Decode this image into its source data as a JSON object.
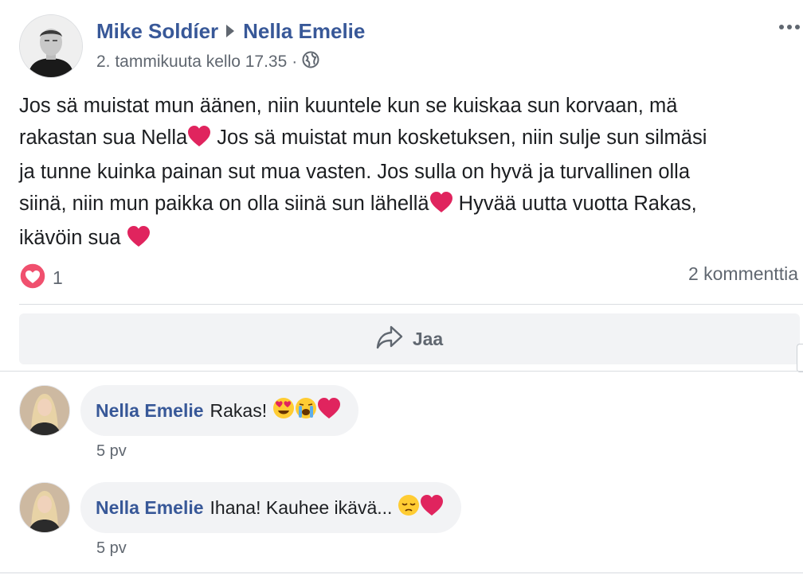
{
  "post": {
    "author": "Mike Soldíer",
    "recipient": "Nella Emelie",
    "timestamp": "2. tammikuuta kello 17.35",
    "separator": "·",
    "privacy_icon": "globe-icon",
    "more_icon": "more-dots-icon",
    "text_lines": [
      "Jos sä muistat mun äänen, niin kuuntele kun se kuiskaa sun korvaan, mä",
      "rakastan sua Nella",
      " Jos sä muistat mun kosketuksen, niin sulje sun silmäsi",
      "ja tunne kuinka painan sut mua vasten. Jos sulla on hyvä ja turvallinen olla",
      "siinä, niin mun paikka on olla siinä sun lähellä",
      " Hyvää uutta vuotta Rakas,",
      "ikävöin sua "
    ]
  },
  "reactions": {
    "icon": "love-reaction-icon",
    "count": "1",
    "comments_count": "2 kommenttia"
  },
  "actions": {
    "share_icon": "share-arrow-icon",
    "share_label": "Jaa"
  },
  "comments": [
    {
      "author": "Nella Emelie",
      "text": "Rakas!",
      "emojis": [
        "heart-eyes-emoji",
        "loudly-crying-emoji",
        "red-heart-emoji"
      ],
      "time": "5 pv"
    },
    {
      "author": "Nella Emelie",
      "text": "Ihana! Kauhee ikävä...",
      "emojis": [
        "pensive-face-emoji",
        "red-heart-emoji"
      ],
      "time": "5 pv"
    }
  ],
  "colors": {
    "link_blue": "#385898",
    "meta_gray": "#606770",
    "text": "#1c1e21",
    "heart_red": "#e0245e",
    "bubble_bg": "#f2f3f5"
  }
}
